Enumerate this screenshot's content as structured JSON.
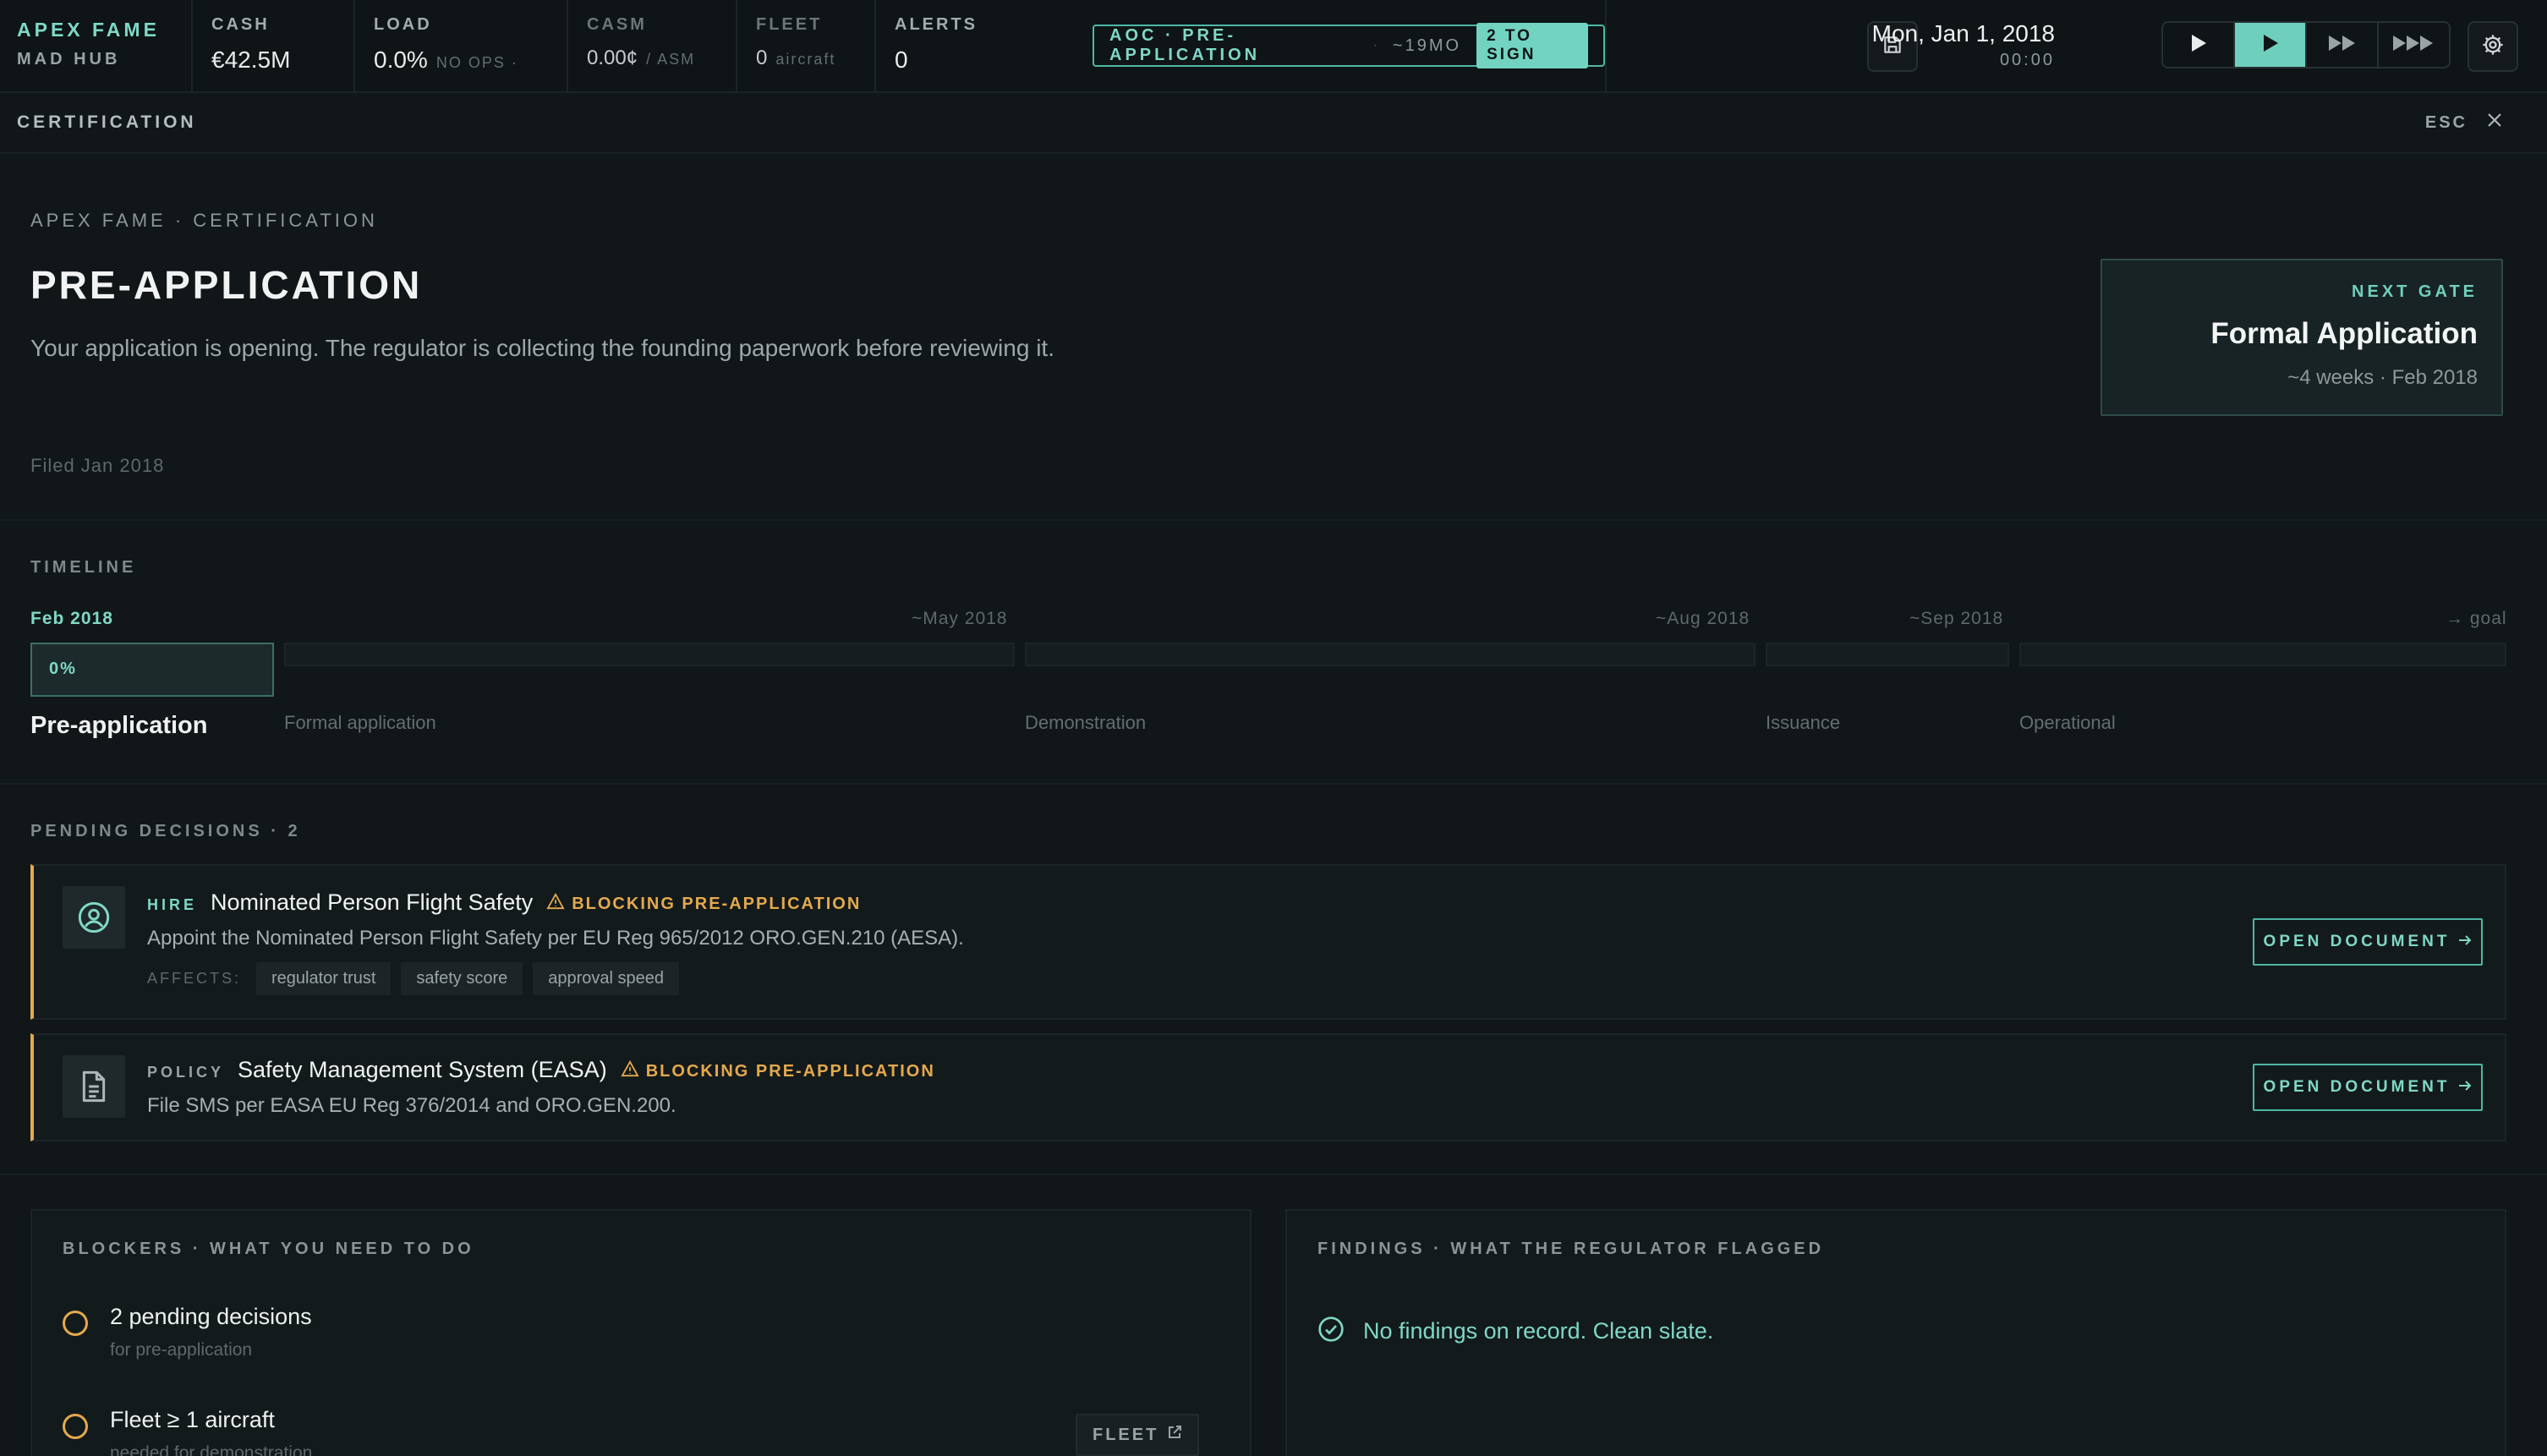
{
  "topbar": {
    "brand_name": "APEX FAME",
    "hub": "MAD HUB",
    "cash": {
      "label": "CASH",
      "value": "€42.5M"
    },
    "load": {
      "label": "LOAD",
      "value": "0.0%",
      "sub": "NO OPS ·"
    },
    "casm": {
      "label": "CASM",
      "value": "0.00¢",
      "sub": "/ ASM"
    },
    "fleet": {
      "label": "FLEET",
      "value": "0",
      "sub": "aircraft"
    },
    "alerts": {
      "label": "ALERTS",
      "value": "0"
    },
    "aoc": {
      "stage": "AOC · PRE-APPLICATION",
      "sep": "·",
      "eta": "~19MO",
      "sign": "2 TO SIGN"
    },
    "date": "Mon, Jan 1, 2018",
    "time": "00:00"
  },
  "subheader": {
    "title": "CERTIFICATION",
    "esc": "ESC"
  },
  "hero": {
    "breadcrumb": "APEX FAME · CERTIFICATION",
    "title": "PRE-APPLICATION",
    "lead": "Your application is opening. The regulator is collecting the founding paperwork before reviewing it.",
    "filed": "Filed Jan 2018",
    "next_gate": {
      "kicker": "NEXT GATE",
      "name": "Formal Application",
      "meta": "~4 weeks · Feb 2018"
    }
  },
  "timeline": {
    "label": "TIMELINE",
    "current_progress_pct": 0,
    "phases": [
      {
        "date": "Feb 2018",
        "name": "Pre-application",
        "pct": "0%"
      },
      {
        "date": "~May 2018",
        "name": "Formal application"
      },
      {
        "date": "~Aug 2018",
        "name": "Demonstration"
      },
      {
        "date": "~Sep 2018",
        "name": "Issuance"
      },
      {
        "date": "→ goal",
        "name": "Operational"
      }
    ]
  },
  "decisions": {
    "label": "PENDING DECISIONS · 2",
    "items": [
      {
        "kind": "HIRE",
        "title": "Nominated Person Flight Safety",
        "blocking": "BLOCKING PRE-APPLICATION",
        "desc": "Appoint the Nominated Person Flight Safety per EU Reg 965/2012 ORO.GEN.210 (AESA).",
        "affects_label": "AFFECTS:",
        "affects": [
          "regulator trust",
          "safety score",
          "approval speed"
        ],
        "button": "OPEN DOCUMENT"
      },
      {
        "kind": "POLICY",
        "title": "Safety Management System (EASA)",
        "blocking": "BLOCKING PRE-APPLICATION",
        "desc": "File SMS per EASA EU Reg 376/2014 and ORO.GEN.200.",
        "button": "OPEN DOCUMENT"
      }
    ]
  },
  "blockers": {
    "label": "BLOCKERS · WHAT YOU NEED TO DO",
    "items": [
      {
        "title": "2 pending decisions",
        "sub": "for pre-application"
      },
      {
        "title": "Fleet ≥ 1 aircraft",
        "sub": "needed for demonstration",
        "link": "FLEET"
      }
    ]
  },
  "findings": {
    "label": "FINDINGS · WHAT THE REGULATOR FLAGGED",
    "empty": "No findings on record. Clean slate."
  },
  "colors": {
    "accent": "#7fd8c6",
    "warning": "#e4a94e",
    "background": "#111618"
  }
}
